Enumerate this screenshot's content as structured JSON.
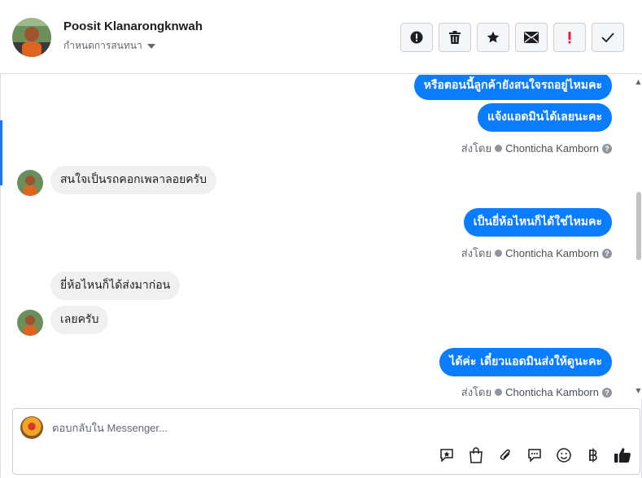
{
  "header": {
    "contact_name": "Poosit Klanarongknwah",
    "contact_subtitle": "กำหนดการสนทนา",
    "actions": [
      {
        "name": "report-icon"
      },
      {
        "name": "trash-icon"
      },
      {
        "name": "star-icon"
      },
      {
        "name": "envelope-icon"
      },
      {
        "name": "exclamation-icon"
      },
      {
        "name": "check-icon"
      }
    ]
  },
  "conversation": {
    "messages": [
      {
        "direction": "out",
        "text": "หรือตอนนี้ลูกค้ายังสนใจรถอยู่ไหมคะ"
      },
      {
        "direction": "out",
        "text": "แจ้งแอดมินได้เลยนะคะ"
      },
      {
        "direction": "meta",
        "sent_by_label": "ส่งโดย",
        "agent": "Chonticha Kamborn"
      },
      {
        "direction": "in",
        "text": "สนใจเป็นรถคอกเพลาลอยครับ"
      },
      {
        "direction": "out",
        "text": "เป็นยี่ห้อไหนก็ได้ใช่ไหมคะ"
      },
      {
        "direction": "meta",
        "sent_by_label": "ส่งโดย",
        "agent": "Chonticha Kamborn"
      },
      {
        "direction": "in",
        "text": "ยี่ห้อไหนก็ได้ส่งมาก่อน"
      },
      {
        "direction": "in",
        "text": "เลยครับ"
      },
      {
        "direction": "out",
        "text": "ได้ค่ะ เดี๋ยวแอดมินส่งให้ดูนะคะ"
      },
      {
        "direction": "meta",
        "sent_by_label": "ส่งโดย",
        "agent": "Chonticha Kamborn"
      }
    ]
  },
  "composer": {
    "placeholder": "ตอบกลับใน Messenger...",
    "tools": [
      "saved-reply-icon",
      "shopping-bag-icon",
      "paperclip-icon",
      "chat-bubble-icon",
      "emoji-icon",
      "baht-icon",
      "thumbs-up-icon"
    ]
  },
  "colors": {
    "outgoing_bubble": "#0a7cff",
    "incoming_bubble": "#f0f0f0",
    "accent": "#1877f2"
  }
}
